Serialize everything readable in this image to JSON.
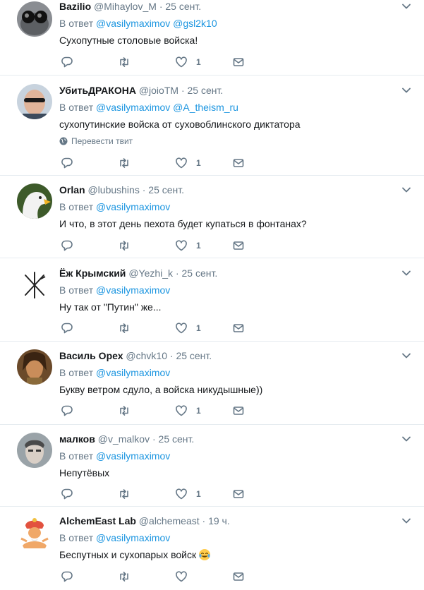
{
  "reply_prefix": "В ответ",
  "translate_label": "Перевести твит",
  "tweets": [
    {
      "name": "Bazilio",
      "handle": "@Mihaylov_M",
      "dot": "·",
      "time": "25 сент.",
      "mentions": [
        "@vasilymaximov",
        "@gsl2k10"
      ],
      "text": "Сухопутные столовые войска!",
      "likes": "1"
    },
    {
      "name": "УбитьДРАКОНА",
      "handle": "@joioTM",
      "dot": "·",
      "time": "25 сент.",
      "mentions": [
        "@vasilymaximov",
        "@A_theism_ru"
      ],
      "text": "сухопутинские войска от суховоблинского диктатора",
      "likes": "1"
    },
    {
      "name": "Orlan",
      "handle": "@lubushins",
      "dot": "·",
      "time": "25 сент.",
      "mentions": [
        "@vasilymaximov"
      ],
      "text": "И что, в этот день пехота будет купаться в фонтанах?",
      "likes": "1"
    },
    {
      "name": "Ёж Крымский",
      "handle": "@Yezhi_k",
      "dot": "·",
      "time": "25 сент.",
      "mentions": [
        "@vasilymaximov"
      ],
      "text": "Ну так от \"Путин\" же...",
      "likes": "1"
    },
    {
      "name": "Василь Орех",
      "handle": "@chvk10",
      "dot": "·",
      "time": "25 сент.",
      "mentions": [
        "@vasilymaximov"
      ],
      "text": "Букву ветром сдуло, а войска никудышные))",
      "likes": "1"
    },
    {
      "name": "малков",
      "handle": "@v_malkov",
      "dot": "·",
      "time": "25 сент.",
      "mentions": [
        "@vasilymaximov"
      ],
      "text": "Непутёвых",
      "likes": "1"
    },
    {
      "name": "AlchemEast Lab",
      "handle": "@alchemeast",
      "dot": "·",
      "time": "19 ч.",
      "mentions": [
        "@vasilymaximov"
      ],
      "text": "Беспутных и сухопарых войск",
      "likes": ""
    }
  ]
}
